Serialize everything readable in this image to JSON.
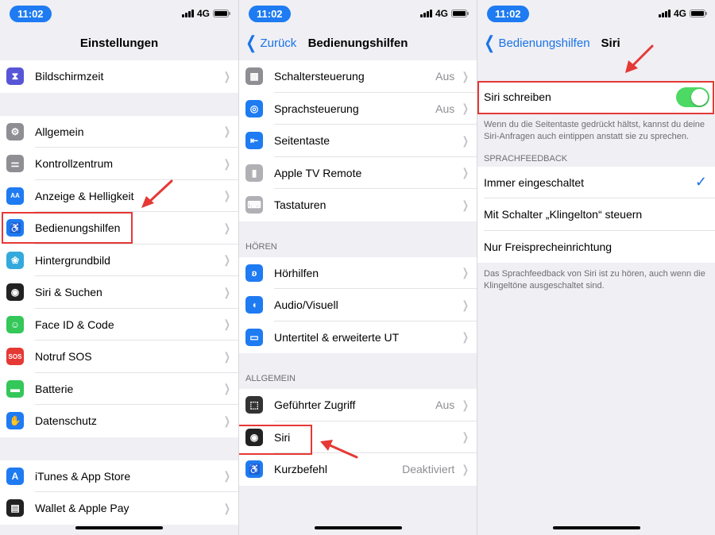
{
  "status": {
    "time": "11:02",
    "network": "4G"
  },
  "screen1": {
    "title": "Einstellungen",
    "group1": [
      {
        "label": "Bildschirmzeit",
        "icon": "hourglass-icon",
        "color": "#5856d6"
      }
    ],
    "group2": [
      {
        "label": "Allgemein",
        "icon": "gear-icon",
        "color": "#8e8e93"
      },
      {
        "label": "Kontrollzentrum",
        "icon": "toggles-icon",
        "color": "#8e8e93"
      },
      {
        "label": "Anzeige & Helligkeit",
        "icon": "text-size-icon",
        "color": "#1e7bf2",
        "glyph": "AA"
      },
      {
        "label": "Bedienungshilfen",
        "icon": "accessibility-icon",
        "color": "#1e7bf2"
      },
      {
        "label": "Hintergrundbild",
        "icon": "flower-icon",
        "color": "#34aadc"
      },
      {
        "label": "Siri & Suchen",
        "icon": "siri-icon",
        "color": "#222222"
      },
      {
        "label": "Face ID & Code",
        "icon": "face-id-icon",
        "color": "#34c759"
      },
      {
        "label": "Notruf SOS",
        "icon": "sos-icon",
        "color": "#e53935",
        "glyph": "SOS"
      },
      {
        "label": "Batterie",
        "icon": "battery-icon",
        "color": "#34c759"
      },
      {
        "label": "Datenschutz",
        "icon": "hand-icon",
        "color": "#1e7bf2"
      }
    ],
    "group3": [
      {
        "label": "iTunes & App Store",
        "icon": "app-store-icon",
        "color": "#1e7bf2"
      },
      {
        "label": "Wallet & Apple Pay",
        "icon": "wallet-icon",
        "color": "#222222"
      }
    ]
  },
  "screen2": {
    "back": "Zurück",
    "title": "Bedienungshilfen",
    "group1": [
      {
        "label": "Schaltersteuerung",
        "value": "Aus",
        "icon": "switch-control-icon",
        "color": "#8e8e93"
      },
      {
        "label": "Sprachsteuerung",
        "value": "Aus",
        "icon": "voice-control-icon",
        "color": "#1e7bf2"
      },
      {
        "label": "Seitentaste",
        "value": "",
        "icon": "side-button-icon",
        "color": "#1e7bf2"
      },
      {
        "label": "Apple TV Remote",
        "value": "",
        "icon": "remote-icon",
        "color": "#b0b0b5"
      },
      {
        "label": "Tastaturen",
        "value": "",
        "icon": "keyboard-icon",
        "color": "#b0b0b5"
      }
    ],
    "section_hoeren": "HÖREN",
    "group2": [
      {
        "label": "Hörhilfen",
        "value": "",
        "icon": "ear-icon",
        "color": "#1e7bf2"
      },
      {
        "label": "Audio/Visuell",
        "value": "",
        "icon": "speaker-icon",
        "color": "#1e7bf2"
      },
      {
        "label": "Untertitel & erweiterte UT",
        "value": "",
        "icon": "subtitles-icon",
        "color": "#1e7bf2"
      }
    ],
    "section_allgemein": "ALLGEMEIN",
    "group3": [
      {
        "label": "Geführter Zugriff",
        "value": "Aus",
        "icon": "lock-icon",
        "color": "#333333"
      },
      {
        "label": "Siri",
        "value": "",
        "icon": "siri-icon",
        "color": "#222222"
      },
      {
        "label": "Kurzbefehl",
        "value": "Deaktiviert",
        "icon": "accessibility-icon",
        "color": "#1e7bf2"
      }
    ]
  },
  "screen3": {
    "back": "Bedienungshilfen",
    "title": "Siri",
    "toggle_label": "Siri schreiben",
    "toggle_on": true,
    "toggle_description": "Wenn du die Seitentaste gedrückt hältst, kannst du deine Siri-Anfragen auch eintippen anstatt sie zu sprechen.",
    "section_feedback": "SPRACHFEEDBACK",
    "options": [
      {
        "label": "Immer eingeschaltet",
        "selected": true
      },
      {
        "label": "Mit Schalter „Klingelton“ steuern",
        "selected": false
      },
      {
        "label": "Nur Freisprecheinrichtung",
        "selected": false
      }
    ],
    "feedback_description": "Das Sprachfeedback von Siri ist zu hören, auch wenn die Klingeltöne ausgeschaltet sind."
  },
  "colors": {
    "accent": "#1a73e8",
    "highlight": "#e53935",
    "toggle_on": "#4cd964"
  }
}
